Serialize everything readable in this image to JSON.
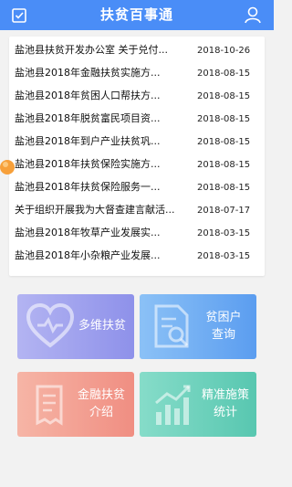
{
  "header": {
    "title": "扶贫百事通",
    "left_icon": "checkbox-icon",
    "right_icon": "user-icon",
    "color": "#4a8df7"
  },
  "news": [
    {
      "title": "盐池县扶贫开发办公室 关于兑付...",
      "date": "2018-10-26"
    },
    {
      "title": "盐池县2018年金融扶贫实施方...",
      "date": "2018-08-15"
    },
    {
      "title": "盐池县2018年贫困人口帮扶方...",
      "date": "2018-08-15"
    },
    {
      "title": "盐池县2018年脱贫富民项目资...",
      "date": "2018-08-15"
    },
    {
      "title": "盐池县2018年到户产业扶贫巩...",
      "date": "2018-08-15"
    },
    {
      "title": "盐池县2018年扶贫保险实施方...",
      "date": "2018-08-15"
    },
    {
      "title": "盐池县2018年扶贫保险服务一...",
      "date": "2018-08-15"
    },
    {
      "title": "关于组织开展我为大督查建言献活...",
      "date": "2018-07-17"
    },
    {
      "title": "盐池县2018年牧草产业发展实...",
      "date": "2018-03-15"
    },
    {
      "title": "盐池县2018年小杂粮产业发展...",
      "date": "2018-03-15"
    }
  ],
  "tiles": {
    "multi_dim": {
      "label": "多维扶贫",
      "icon": "heart-icon"
    },
    "poor_household": {
      "label_line1": "贫困户",
      "label_line2": "查询",
      "icon": "document-search-icon"
    },
    "finance": {
      "label_line1": "金融扶贫",
      "label_line2": "介绍",
      "icon": "scroll-icon"
    },
    "stats": {
      "label_line1": "精准施策",
      "label_line2": "统计",
      "icon": "bar-chart-icon"
    }
  }
}
